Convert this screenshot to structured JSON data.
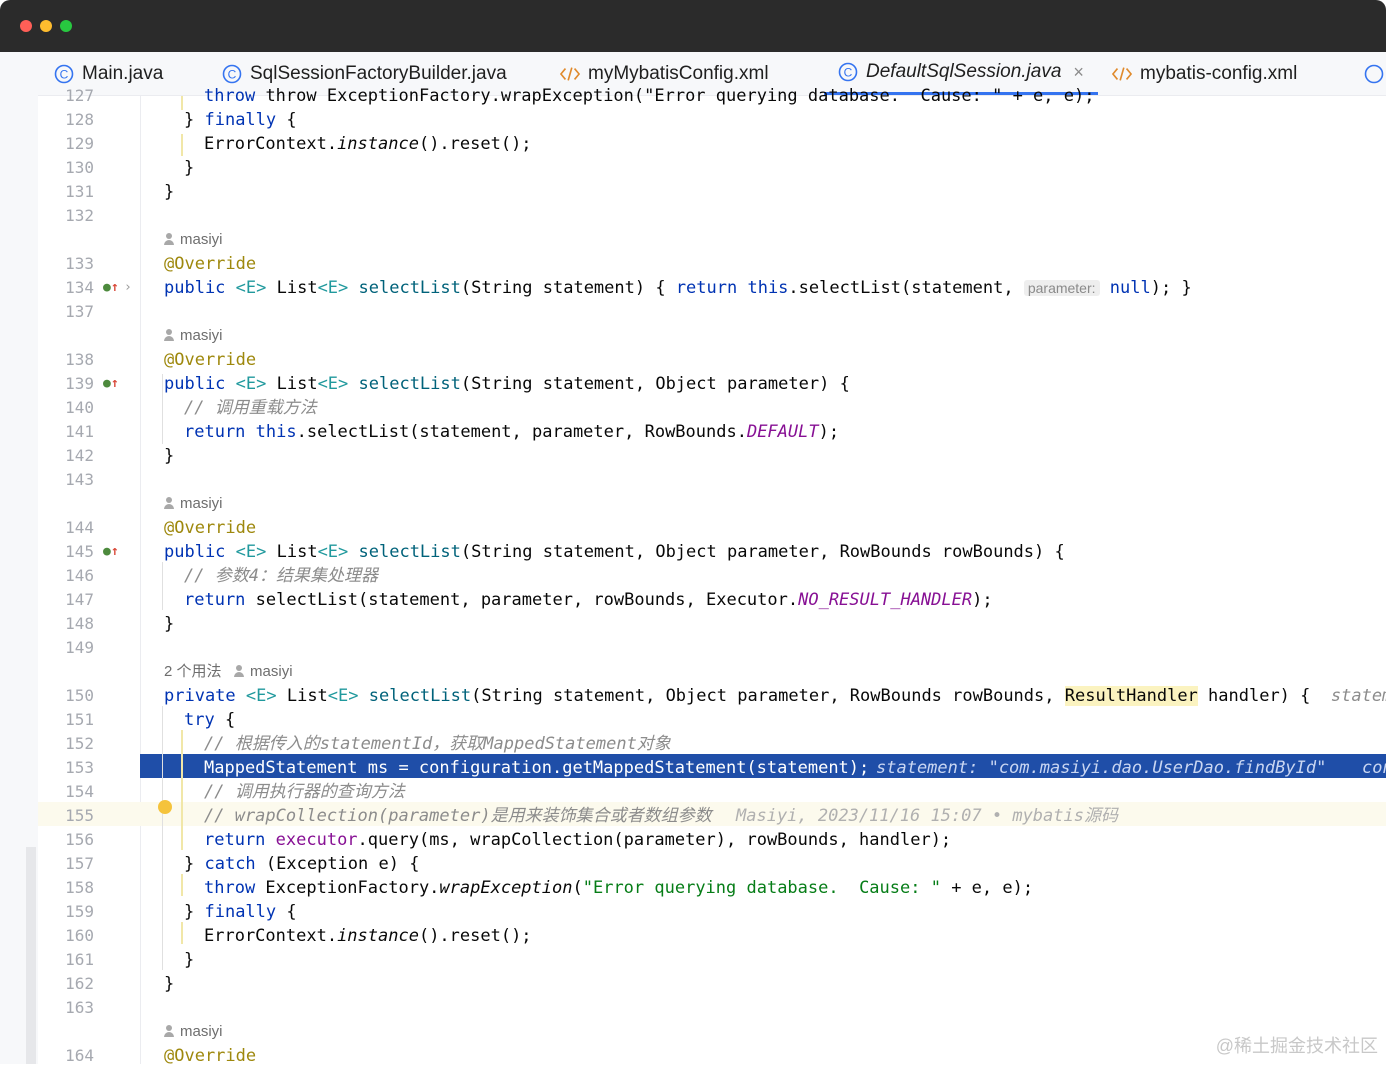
{
  "window": {
    "colors": {
      "close": "#ff5f57",
      "minimize": "#febc2e",
      "maximize": "#28c840"
    }
  },
  "tabs": [
    {
      "label": "Main.java",
      "icon": "java-class-icon"
    },
    {
      "label": "SqlSessionFactoryBuilder.java",
      "icon": "java-class-icon"
    },
    {
      "label": "myMybatisConfig.xml",
      "icon": "xml-file-icon"
    },
    {
      "label": "DefaultSqlSession.java",
      "icon": "java-class-icon",
      "active": true
    },
    {
      "label": "mybatis-config.xml",
      "icon": "xml-file-icon"
    }
  ],
  "tab_close": "×",
  "line_numbers": {
    "l127": "127",
    "l128": "128",
    "l129": "129",
    "l130": "130",
    "l131": "131",
    "l132": "132",
    "l133": "133",
    "l134": "134",
    "l137": "137",
    "l138": "138",
    "l139": "139",
    "l140": "140",
    "l141": "141",
    "l142": "142",
    "l143": "143",
    "l144": "144",
    "l145": "145",
    "l146": "146",
    "l147": "147",
    "l148": "148",
    "l149": "149",
    "l150": "150",
    "l151": "151",
    "l152": "152",
    "l153": "153",
    "l154": "154",
    "l155": "155",
    "l156": "156",
    "l157": "157",
    "l158": "158",
    "l159": "159",
    "l160": "160",
    "l161": "161",
    "l162": "162",
    "l163": "163",
    "l164": "164"
  },
  "authors": {
    "a1": "masiyi",
    "a2": "masiyi",
    "a3": "masiyi",
    "usages": "2 个用法",
    "a4": "masiyi",
    "a5": "masiyi"
  },
  "hints": {
    "parameter": "parameter:"
  },
  "inline": {
    "l150_tail": "statemen",
    "l153_debug": "statement: \"com.masiyi.dao.UserDao.findById\"",
    "l153_tail": "con",
    "l155_blame": "Masiyi, 2023/11/16 15:07 • mybatis源码"
  },
  "code": {
    "l127": "throw ExceptionFactory.wrapException(\"Error querying database.  Cause: \" + e, e);",
    "l128_a": "} ",
    "l128_b": "finally",
    "l128_c": " {",
    "l129_a": "ErrorContext.",
    "l129_b": "instance",
    "l129_c": "().reset();",
    "l130": "}",
    "l131": "}",
    "l133": "@Override",
    "l134_a": "public",
    "l134_b": " <E> ",
    "l134_c": "List",
    "l134_d": "<E> ",
    "l134_e": "selectList",
    "l134_f": "(String statement) { ",
    "l134_g": "return",
    "l134_h": " this",
    "l134_i": ".selectList(statement, ",
    "l134_j": "null",
    "l134_k": "); }",
    "l138": "@Override",
    "l139_a": "public",
    "l139_b": " <E> ",
    "l139_c": "List",
    "l139_d": "<E> ",
    "l139_e": "selectList",
    "l139_f": "(String statement, Object parameter) {",
    "l140": "// 调用重载方法",
    "l141_a": "return",
    "l141_b": " this",
    "l141_c": ".selectList(statement, parameter, RowBounds.",
    "l141_d": "DEFAULT",
    "l141_e": ");",
    "l142": "}",
    "l144": "@Override",
    "l145_a": "public",
    "l145_b": " <E> ",
    "l145_c": "List",
    "l145_d": "<E> ",
    "l145_e": "selectList",
    "l145_f": "(String statement, Object parameter, RowBounds rowBounds) {",
    "l146": "// 参数4：结果集处理器",
    "l147_a": "return",
    "l147_b": " selectList(statement, parameter, rowBounds, Executor.",
    "l147_c": "NO_RESULT_HANDLER",
    "l147_d": ");",
    "l148": "}",
    "l150_a": "private",
    "l150_b": " <E> ",
    "l150_c": "List",
    "l150_d": "<E> ",
    "l150_e": "selectList",
    "l150_f": "(String statement, Object parameter, RowBounds rowBounds, ",
    "l150_g": "ResultHandler",
    "l150_h": " handler) {",
    "l151_a": "try",
    "l151_b": " {",
    "l152": "// 根据传入的statementId，获取MappedStatement对象",
    "l153": "MappedStatement ms = configuration.getMappedStatement(statement);",
    "l154": "// 调用执行器的查询方法",
    "l155": "// wrapCollection(parameter)是用来装饰集合或者数组参数",
    "l156_a": "return",
    "l156_b": " executor",
    "l156_c": ".query(ms, wrapCollection(parameter), rowBounds, handler);",
    "l157_a": "} ",
    "l157_b": "catch",
    "l157_c": " (Exception e) {",
    "l158_a": "throw",
    "l158_b": " ExceptionFactory.",
    "l158_c": "wrapException",
    "l158_d": "(",
    "l158_e": "\"Error querying database.  Cause: \"",
    "l158_f": " + e, e);",
    "l159_a": "} ",
    "l159_b": "finally",
    "l159_c": " {",
    "l160_a": "ErrorContext.",
    "l160_b": "instance",
    "l160_c": "().reset();",
    "l161": "}",
    "l162": "}",
    "l164": "@Override"
  },
  "watermark": "@稀土掘金技术社区"
}
